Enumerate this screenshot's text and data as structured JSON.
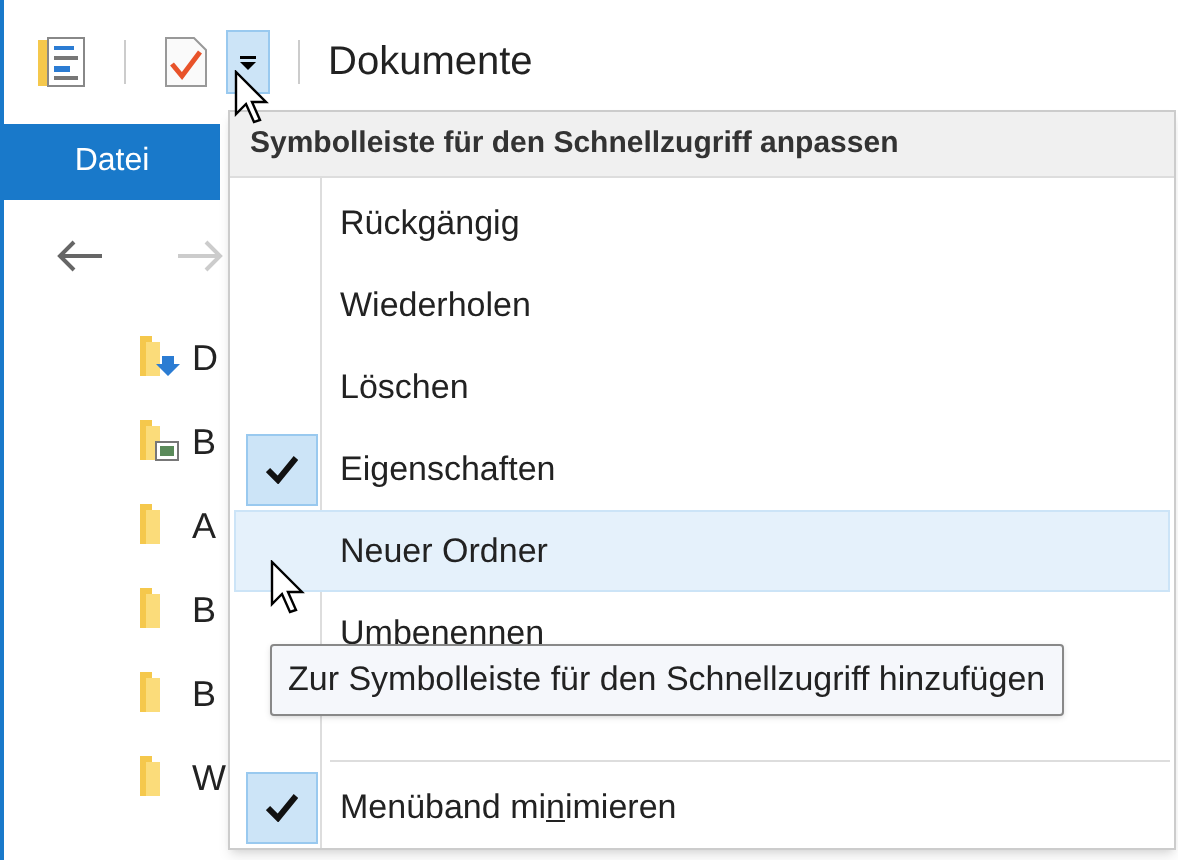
{
  "title_bar": {
    "title": "Dokumente"
  },
  "ribbon": {
    "tabs": [
      {
        "label": "Datei",
        "selected": true
      }
    ]
  },
  "navigation": {
    "back": {
      "disabled": false
    },
    "forward": {
      "disabled": true
    }
  },
  "tree": [
    {
      "label": "D",
      "kind": "downloads"
    },
    {
      "label": "B",
      "kind": "pictures"
    },
    {
      "label": "A",
      "kind": "folder"
    },
    {
      "label": "B",
      "kind": "folder"
    },
    {
      "label": "B",
      "kind": "folder"
    },
    {
      "label": "W",
      "kind": "folder"
    }
  ],
  "menu": {
    "title": "Symbolleiste für den Schnellzugriff anpassen",
    "items": [
      {
        "kind": "item",
        "before": "Rückgängig",
        "checked": false,
        "selected": false
      },
      {
        "kind": "item",
        "before": "Wiederholen",
        "checked": false,
        "selected": false
      },
      {
        "kind": "item",
        "before": "Löschen",
        "checked": false,
        "selected": false
      },
      {
        "kind": "item",
        "before": "Eigenschaften",
        "checked": true,
        "selected": false
      },
      {
        "kind": "item",
        "before": "Neuer Ordner",
        "checked": false,
        "selected": true
      },
      {
        "kind": "item",
        "before": "Umbenennen",
        "checked": false,
        "selected": false
      },
      {
        "kind": "item",
        "checked": false,
        "selected": false
      },
      {
        "kind": "separator"
      },
      {
        "kind": "item",
        "before": "Menüband mi",
        "key": "n",
        "after": "imieren",
        "checked": true,
        "selected": false
      }
    ]
  },
  "tooltip": {
    "text": "Zur Symbolleiste für den Schnellzugriff hinzufügen"
  }
}
